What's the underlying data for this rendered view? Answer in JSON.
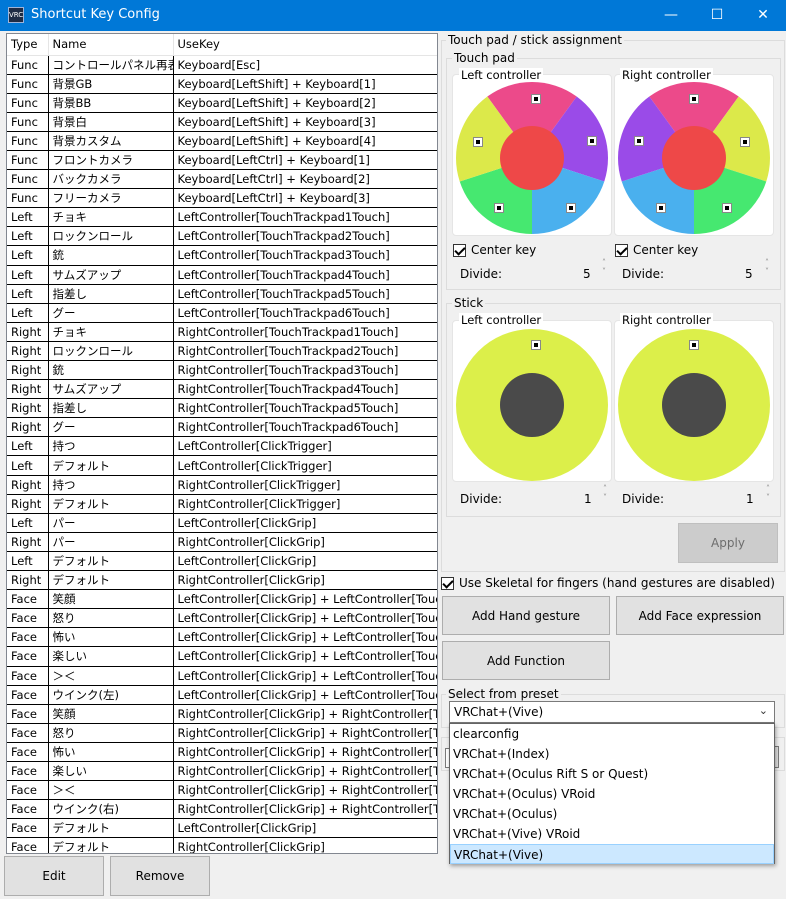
{
  "window": {
    "title": "Shortcut Key Config",
    "icon_text": "VRC",
    "minimize": "—",
    "maximize": "☐",
    "close": "✕"
  },
  "table": {
    "headers": [
      "Type",
      "Name",
      "UseKey"
    ],
    "rows": [
      [
        "Func",
        "コントロールパネル再表示",
        "Keyboard[Esc]"
      ],
      [
        "Func",
        "背景GB",
        "Keyboard[LeftShift] + Keyboard[1]"
      ],
      [
        "Func",
        "背景BB",
        "Keyboard[LeftShift] + Keyboard[2]"
      ],
      [
        "Func",
        "背景白",
        "Keyboard[LeftShift] + Keyboard[3]"
      ],
      [
        "Func",
        "背景カスタム",
        "Keyboard[LeftShift] + Keyboard[4]"
      ],
      [
        "Func",
        "フロントカメラ",
        "Keyboard[LeftCtrl] + Keyboard[1]"
      ],
      [
        "Func",
        "バックカメラ",
        "Keyboard[LeftCtrl] + Keyboard[2]"
      ],
      [
        "Func",
        "フリーカメラ",
        "Keyboard[LeftCtrl] + Keyboard[3]"
      ],
      [
        "Left",
        "チョキ",
        "LeftController[TouchTrackpad1Touch]"
      ],
      [
        "Left",
        "ロックンロール",
        "LeftController[TouchTrackpad2Touch]"
      ],
      [
        "Left",
        "銃",
        "LeftController[TouchTrackpad3Touch]"
      ],
      [
        "Left",
        "サムズアップ",
        "LeftController[TouchTrackpad4Touch]"
      ],
      [
        "Left",
        "指差し",
        "LeftController[TouchTrackpad5Touch]"
      ],
      [
        "Left",
        "グー",
        "LeftController[TouchTrackpad6Touch]"
      ],
      [
        "Right",
        "チョキ",
        "RightController[TouchTrackpad1Touch]"
      ],
      [
        "Right",
        "ロックンロール",
        "RightController[TouchTrackpad2Touch]"
      ],
      [
        "Right",
        "銃",
        "RightController[TouchTrackpad3Touch]"
      ],
      [
        "Right",
        "サムズアップ",
        "RightController[TouchTrackpad4Touch]"
      ],
      [
        "Right",
        "指差し",
        "RightController[TouchTrackpad5Touch]"
      ],
      [
        "Right",
        "グー",
        "RightController[TouchTrackpad6Touch]"
      ],
      [
        "Left",
        "持つ",
        "LeftController[ClickTrigger]"
      ],
      [
        "Left",
        "デフォルト",
        "LeftController[ClickTrigger]"
      ],
      [
        "Right",
        "持つ",
        "RightController[ClickTrigger]"
      ],
      [
        "Right",
        "デフォルト",
        "RightController[ClickTrigger]"
      ],
      [
        "Left",
        "パー",
        "LeftController[ClickGrip]"
      ],
      [
        "Right",
        "パー",
        "RightController[ClickGrip]"
      ],
      [
        "Left",
        "デフォルト",
        "LeftController[ClickGrip]"
      ],
      [
        "Right",
        "デフォルト",
        "RightController[ClickGrip]"
      ],
      [
        "Face",
        "笑顔",
        "LeftController[ClickGrip] + LeftController[TouchTr"
      ],
      [
        "Face",
        "怒り",
        "LeftController[ClickGrip] + LeftController[TouchTr"
      ],
      [
        "Face",
        "怖い",
        "LeftController[ClickGrip] + LeftController[TouchTr"
      ],
      [
        "Face",
        "楽しい",
        "LeftController[ClickGrip] + LeftController[TouchTr"
      ],
      [
        "Face",
        "＞＜",
        "LeftController[ClickGrip] + LeftController[TouchTr"
      ],
      [
        "Face",
        "ウインク(左)",
        "LeftController[ClickGrip] + LeftController[TouchTr"
      ],
      [
        "Face",
        "笑顔",
        "RightController[ClickGrip] + RightController[Touc"
      ],
      [
        "Face",
        "怒り",
        "RightController[ClickGrip] + RightController[Touc"
      ],
      [
        "Face",
        "怖い",
        "RightController[ClickGrip] + RightController[Touc"
      ],
      [
        "Face",
        "楽しい",
        "RightController[ClickGrip] + RightController[Touc"
      ],
      [
        "Face",
        "＞＜",
        "RightController[ClickGrip] + RightController[Touc"
      ],
      [
        "Face",
        "ウインク(右)",
        "RightController[ClickGrip] + RightController[Touc"
      ],
      [
        "Face",
        "デフォルト",
        "LeftController[ClickGrip]"
      ],
      [
        "Face",
        "デフォルト",
        "RightController[ClickGrip]"
      ]
    ]
  },
  "buttons": {
    "edit": "Edit",
    "remove": "Remove",
    "apply": "Apply",
    "add_hand": "Add Hand gesture",
    "add_face": "Add Face expression",
    "add_function": "Add Function"
  },
  "assignment": {
    "title": "Touch pad / stick assignment",
    "touchpad": {
      "title": "Touch pad",
      "left": {
        "label": "Left controller",
        "center_key": "Center key",
        "divide_label": "Divide:",
        "divide": "5"
      },
      "right": {
        "label": "Right controller",
        "center_key": "Center key",
        "divide_label": "Divide:",
        "divide": "5"
      }
    },
    "stick": {
      "title": "Stick",
      "left": {
        "label": "Left controller",
        "divide_label": "Divide:",
        "divide": "1"
      },
      "right": {
        "label": "Right controller",
        "divide_label": "Divide:",
        "divide": "1"
      }
    }
  },
  "skeletal": {
    "label": "Use Skeletal for fingers (hand gestures are disabled)",
    "checked": true
  },
  "preset": {
    "title": "Select from preset",
    "selected": "VRChat+(Vive)",
    "options": [
      "clearconfig",
      "VRChat+(Index)",
      "VRChat+(Oculus Rift S or Quest)",
      "VRChat+(Oculus) VRoid",
      "VRChat+(Oculus)",
      "VRChat+(Vive) VRoid",
      "VRChat+(Vive)"
    ]
  },
  "colors": {
    "pink": "#ec4a8a",
    "purple": "#9a4be8",
    "yellow_green": "#dce94a",
    "green": "#46e870",
    "blue": "#4ab0ee",
    "center_red": "#ee4848",
    "stick_outer": "#dcef4a",
    "stick_center": "#4a4a4a",
    "titlebar": "#0078d7",
    "selected": "#cce8ff"
  }
}
